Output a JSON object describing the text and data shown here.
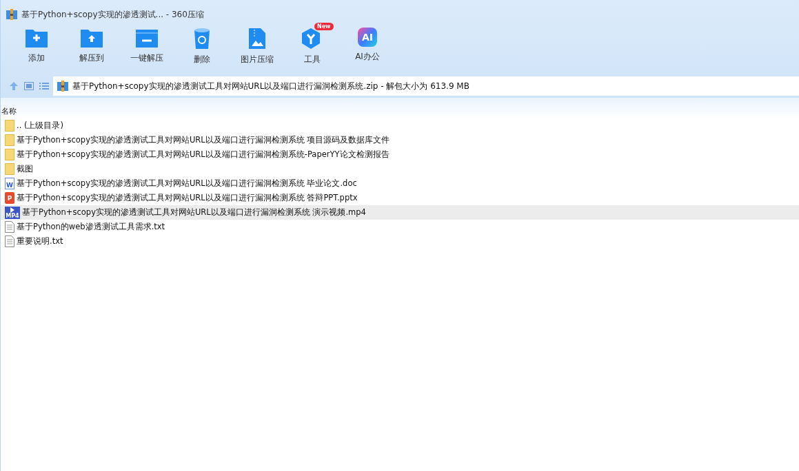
{
  "window": {
    "title": "基于Python+scopy实现的渗透测试... - 360压缩"
  },
  "toolbar": [
    {
      "kind": "add",
      "label": "添加"
    },
    {
      "kind": "extract-to",
      "label": "解压到"
    },
    {
      "kind": "one-click",
      "label": "一键解压"
    },
    {
      "kind": "delete",
      "label": "删除"
    },
    {
      "kind": "image",
      "label": "图片压缩"
    },
    {
      "kind": "tools",
      "label": "工具",
      "badge": "New"
    },
    {
      "kind": "ai",
      "label": "AI办公",
      "glyph": "AI"
    }
  ],
  "address": {
    "path": "基于Python+scopy实现的渗透测试工具对网站URL以及端口进行漏洞检测系统.zip - 解包大小为 613.9 MB"
  },
  "table": {
    "columns": [
      "名称"
    ],
    "rows": [
      {
        "kind": "folder",
        "name": ".. (上级目录)",
        "selected": false
      },
      {
        "kind": "folder",
        "name": "基于Python+scopy实现的渗透测试工具对网站URL以及端口进行漏洞检测系统 项目源码及数据库文件",
        "selected": false
      },
      {
        "kind": "folder",
        "name": "基于Python+scopy实现的渗透测试工具对网站URL以及端口进行漏洞检测系统-PaperYY论文检测报告",
        "selected": false
      },
      {
        "kind": "folder",
        "name": "截图",
        "selected": false
      },
      {
        "kind": "doc",
        "glyph": "W",
        "name": "基于Python+scopy实现的渗透测试工具对网站URL以及端口进行漏洞检测系统 毕业论文.doc",
        "selected": false
      },
      {
        "kind": "ppt",
        "glyph": "P",
        "name": "基于Python+scopy实现的渗透测试工具对网站URL以及端口进行漏洞检测系统 答辩PPT.pptx",
        "selected": false
      },
      {
        "kind": "video",
        "glyph": "MP4",
        "name": "基于Python+scopy实现的渗透测试工具对网站URL以及端口进行漏洞检测系统 演示视频.mp4",
        "selected": true
      },
      {
        "kind": "txt",
        "name": "基于Python的web渗透测试工具需求.txt",
        "selected": false
      },
      {
        "kind": "txt",
        "name": "重要说明.txt",
        "selected": false
      }
    ]
  }
}
